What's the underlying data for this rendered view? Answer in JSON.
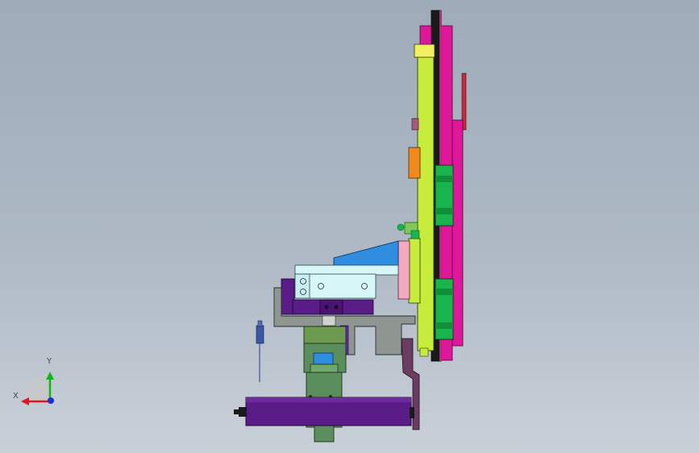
{
  "viewport": {
    "background_top": "#9eabb9",
    "background_bottom": "#c9d0d8"
  },
  "triad": {
    "x_label": "X",
    "y_label": "Y",
    "x_color": "#e3141b",
    "y_color": "#13b51a",
    "z_color": "#1a2fe0"
  },
  "colors": {
    "lime": "#c7ec3c",
    "black": "#1a1a1a",
    "magenta": "#e0179b",
    "pink": "#f3a9c2",
    "red_tab": "#d8233a",
    "orange": "#f08a1c",
    "green": "#18b54c",
    "blue": "#2f8de0",
    "light_cyan": "#d6f6f8",
    "purple": "#5a1c86",
    "gray": "#8f9692",
    "dark_green": "#5b8e5d",
    "olive_green": "#6d9a4f"
  }
}
